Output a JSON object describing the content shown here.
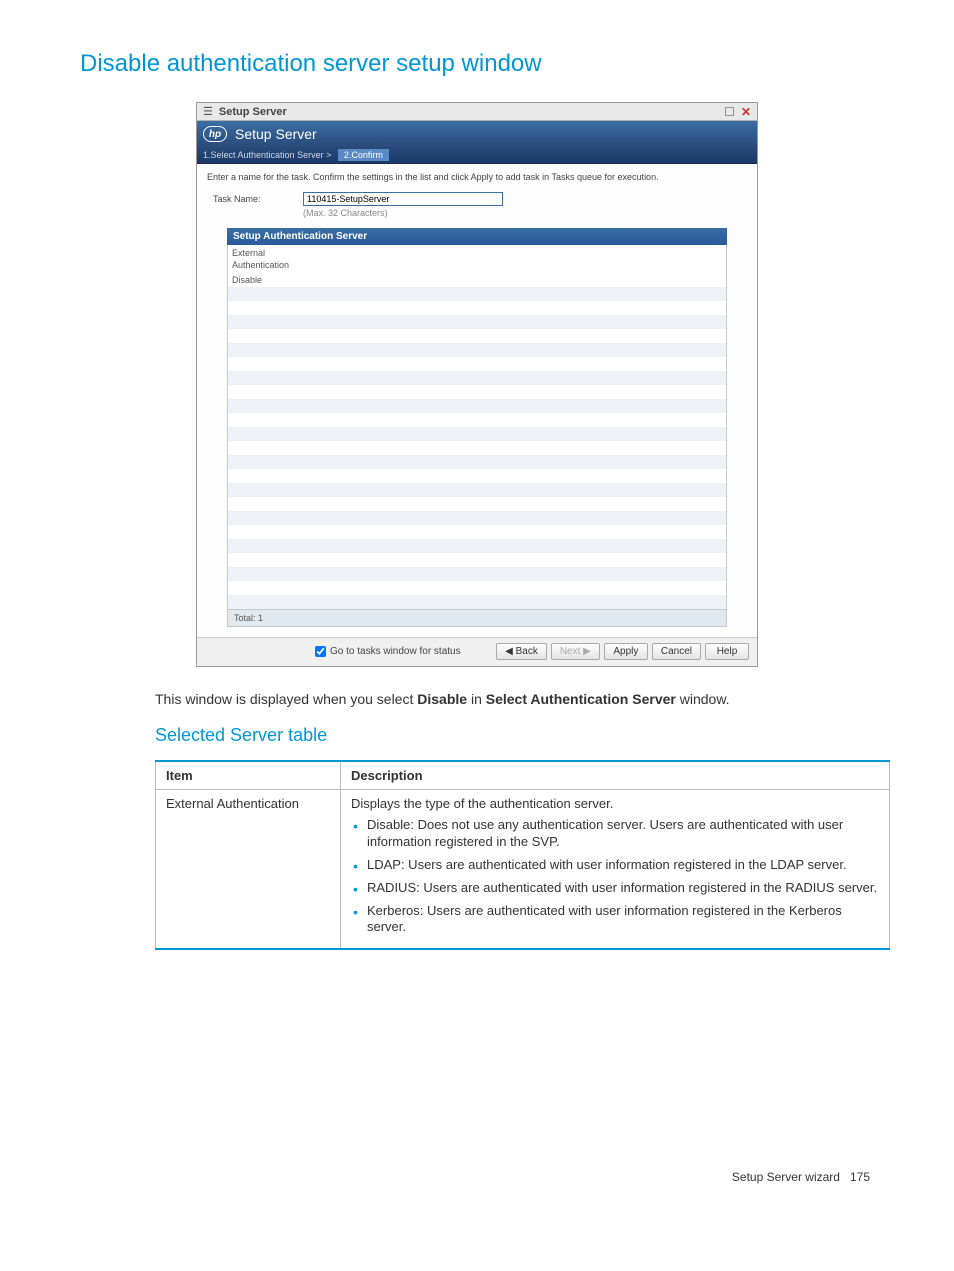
{
  "page": {
    "heading": "Disable authentication server setup window",
    "sub_heading": "Selected Server table",
    "body_text_pre": "This window is displayed when you select ",
    "body_text_bold1": "Disable",
    "body_text_mid": " in ",
    "body_text_bold2": "Select Authentication Server",
    "body_text_post": " window."
  },
  "window": {
    "title_bar": "Setup Server",
    "header": "Setup Server",
    "steps": {
      "step1": "1.Select Authentication Server",
      "sep": ">",
      "step2": "2.Confirm"
    },
    "instructions": "Enter a name for the task. Confirm the settings in the list and click Apply to add task in Tasks queue for execution.",
    "task_name_label": "Task Name:",
    "task_name_value": "110415-SetupServer",
    "task_name_hint": "(Max. 32 Characters)",
    "table_heading": "Setup Authentication Server",
    "table_header_col1_line1": "External",
    "table_header_col1_line2": "Authentication",
    "rows": [
      {
        "c1": "Disable"
      }
    ],
    "blank_rows": 23,
    "total_label": "Total: 1",
    "footer": {
      "checkbox_label": "Go to tasks window for status",
      "back": "Back",
      "next": "Next",
      "apply": "Apply",
      "cancel": "Cancel",
      "help": "Help"
    }
  },
  "doc_table": {
    "headers": {
      "item": "Item",
      "desc": "Description"
    },
    "row": {
      "item": "External Authentication",
      "desc_intro": "Displays the type of the authentication server.",
      "bullets": [
        "Disable: Does not use any authentication server. Users are authenticated with user information registered in the SVP.",
        "LDAP: Users are authenticated with user information registered in the LDAP server.",
        "RADIUS: Users are authenticated with user information registered in the RADIUS server.",
        "Kerberos: Users are authenticated with user information registered in the Kerberos server."
      ]
    }
  },
  "footer": {
    "label": "Setup Server wizard",
    "page_num": "175"
  }
}
